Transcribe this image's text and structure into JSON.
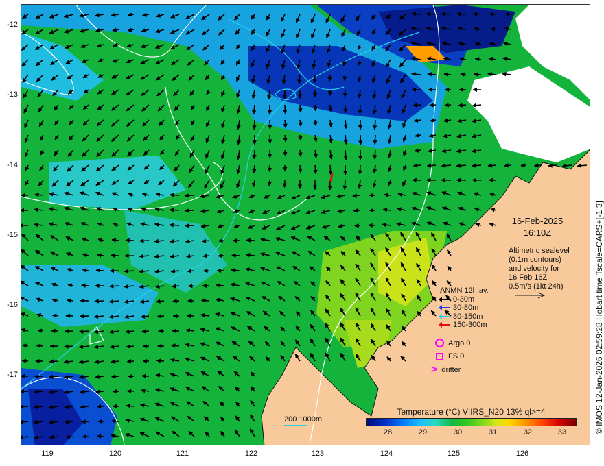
{
  "map": {
    "lat_ticks": [
      "-12",
      "-13",
      "-14",
      "-15",
      "-16",
      "-17"
    ],
    "lon_ticks": [
      "119",
      "120",
      "121",
      "122",
      "123",
      "124",
      "125",
      "126"
    ],
    "land_color": "#f7c99b",
    "no_data_color": "#ffffff",
    "contour_colors": [
      "#ffffff",
      "#2ad2e8"
    ]
  },
  "annotations": {
    "date": "16-Feb-2025",
    "time": "16:10Z",
    "altimetry_lines": [
      "Altimetric sealevel",
      "(0.1m contours)",
      "and velocity for",
      "16 Feb 16Z",
      "0.5m/s (1kt 24h)"
    ]
  },
  "legend": {
    "title": "ANMN 12h av.",
    "items": [
      {
        "label": "0-30m",
        "color": "#000000"
      },
      {
        "label": "30-80m",
        "color": "#1a3cff"
      },
      {
        "label": "80-150m",
        "color": "#28c8e6"
      },
      {
        "label": "150-300m",
        "color": "#e01010"
      }
    ],
    "argo": "Argo 0",
    "fs": "FS 0",
    "drifter": "drifter",
    "symbol_color": "#ff00ff"
  },
  "colorbar": {
    "title": "Temperature (°C) VIIRS_N20 13% ql>=4",
    "ticks": [
      "28",
      "29",
      "30",
      "31",
      "32",
      "33"
    ]
  },
  "depth_scale": {
    "label": "200  1000m",
    "color": "#2ad2e8"
  },
  "side_label": "© IMOS 12-Jan-2026 02:59:28 Hobart time Tscale=CARS+[-1 3]"
}
